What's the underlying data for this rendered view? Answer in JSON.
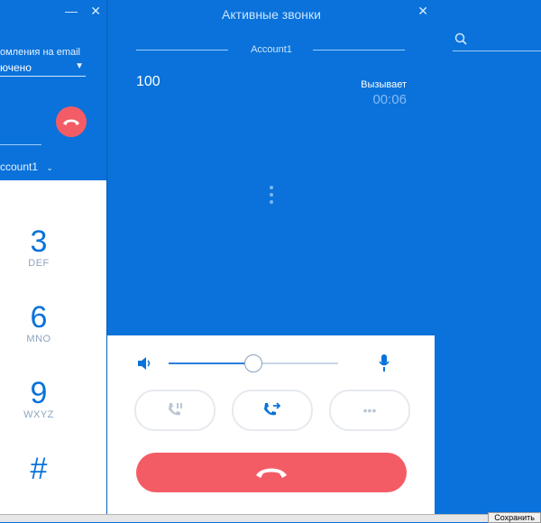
{
  "left_window": {
    "email_note": "омления на email",
    "select_value": "ючено",
    "account_value": "ccount1",
    "keys": [
      {
        "digit": "3",
        "letters": "DEF"
      },
      {
        "digit": "6",
        "letters": "MNO"
      },
      {
        "digit": "9",
        "letters": "WXYZ"
      },
      {
        "digit": "#",
        "letters": ""
      }
    ]
  },
  "active_calls": {
    "title": "Активные звонки",
    "account": "Account1",
    "call": {
      "number": "100",
      "status": "Вызывает",
      "timer": "00:06"
    }
  },
  "bottom": {
    "save_label": "Сохранить"
  },
  "colors": {
    "blue": "#0a72da",
    "red": "#f45c65",
    "white": "#ffffff"
  }
}
